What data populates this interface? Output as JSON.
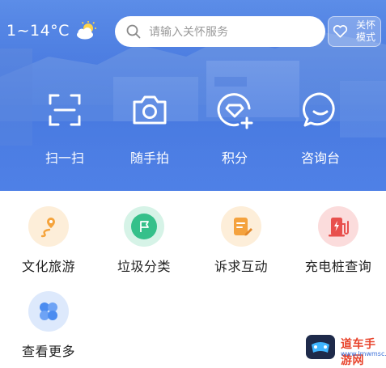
{
  "header": {
    "temperature": "1~14°C",
    "weather_icon": "partly-cloudy-icon",
    "search_placeholder": "请输入关怀服务",
    "care_mode_line1": "关怀",
    "care_mode_line2": "模式"
  },
  "quick_actions": [
    {
      "label": "扫一扫",
      "icon": "scan-icon"
    },
    {
      "label": "随手拍",
      "icon": "camera-icon"
    },
    {
      "label": "积分",
      "icon": "points-icon"
    },
    {
      "label": "咨询台",
      "icon": "chat-icon"
    }
  ],
  "services": [
    {
      "label": "文化旅游",
      "icon": "location-route-icon",
      "color": "#f5a33b"
    },
    {
      "label": "垃圾分类",
      "icon": "flag-icon",
      "color": "#35c08a"
    },
    {
      "label": "诉求互动",
      "icon": "document-edit-icon",
      "color": "#f4a23e"
    },
    {
      "label": "充电桩查询",
      "icon": "charging-station-icon",
      "color": "#e8504d"
    },
    {
      "label": "查看更多",
      "icon": "more-grid-icon",
      "color": "#4b8cf0"
    }
  ],
  "watermark": {
    "text": "道车手游网",
    "url": "www.lmwmsc.com"
  },
  "colors": {
    "hero_blue": "#4f7fe0",
    "text_dark": "#222222",
    "placeholder_gray": "#9a9a9a"
  }
}
